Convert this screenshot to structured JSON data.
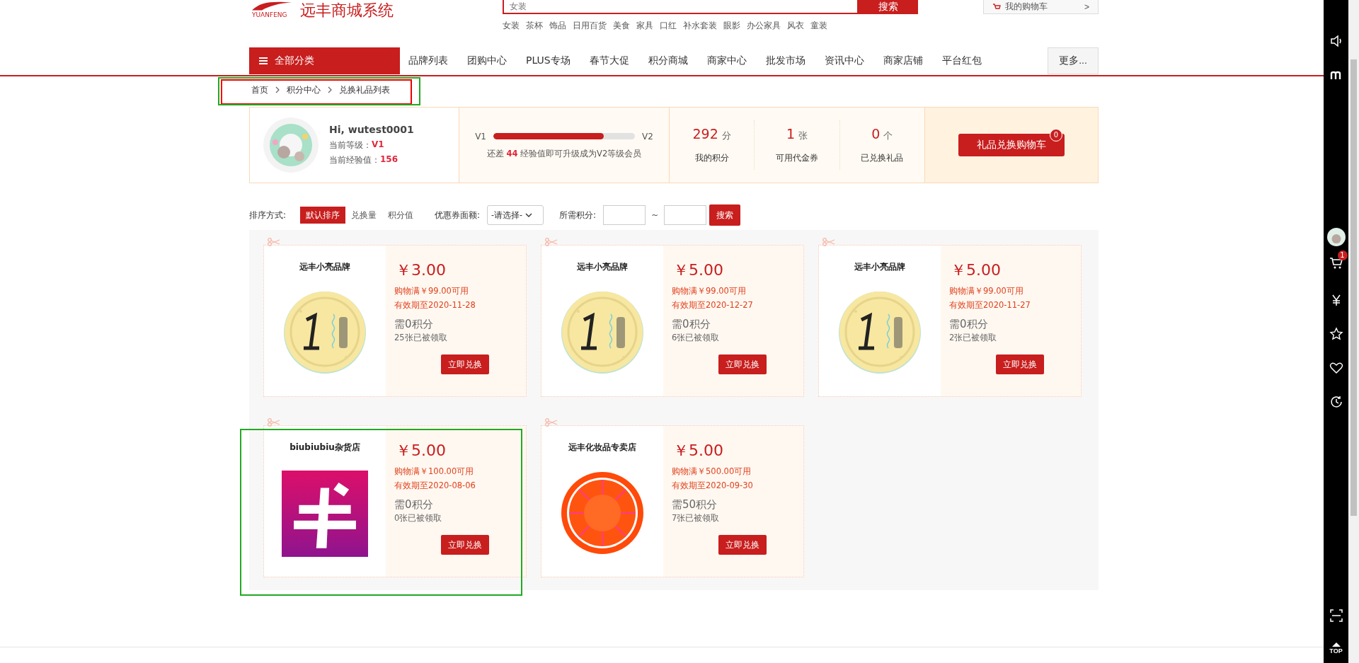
{
  "header": {
    "logo_text": "远丰商城系统",
    "logo_sub": "YUANFENG",
    "search_placeholder": "女装",
    "search_button": "搜索",
    "cart_button": "我的购物车",
    "cart_arrow": ">",
    "hot_words": [
      "女装",
      "茶杯",
      "饰品",
      "日用百货",
      "美食",
      "家具",
      "口红",
      "补水套装",
      "眼影",
      "办公家具",
      "风衣",
      "童装"
    ]
  },
  "nav": {
    "all_categories": "全部分类",
    "items": [
      {
        "label": "品牌列表",
        "selected": false
      },
      {
        "label": "团购中心",
        "selected": false
      },
      {
        "label": "PLUS专场",
        "selected": false
      },
      {
        "label": "春节大促",
        "selected": false
      },
      {
        "label": "积分商城",
        "selected": false
      },
      {
        "label": "商家中心",
        "selected": false
      },
      {
        "label": "批发市场",
        "selected": false
      },
      {
        "label": "资讯中心",
        "selected": false
      },
      {
        "label": "商家店铺",
        "selected": false
      },
      {
        "label": "平台红包",
        "selected": false
      }
    ],
    "more": "更多..."
  },
  "breadcrumb": [
    "首页",
    "积分中心",
    "兑换礼品列表"
  ],
  "user": {
    "greeting": "Hi, wutest0001",
    "level_label": "当前等级：",
    "level": "V1",
    "exp_label": "当前经验值：",
    "exp": "156",
    "progress": {
      "from": "V1",
      "to": "V2",
      "level": 0.78,
      "note_before": "还差",
      "note_value": "44",
      "note_after": "经验值即可升级成为V2等级会员"
    },
    "stats": [
      {
        "value": "292",
        "unit": "分",
        "label": "我的积分"
      },
      {
        "value": "1",
        "unit": "张",
        "label": "可用代金券"
      },
      {
        "value": "0",
        "unit": "个",
        "label": "已兑换礼品"
      }
    ],
    "cart_button": "礼品兑换购物车",
    "cart_count": "0"
  },
  "filters": {
    "sort_label": "排序方式:",
    "sorts": [
      {
        "label": "默认排序",
        "selected": true
      },
      {
        "label": "兑换量",
        "selected": false
      },
      {
        "label": "积分值",
        "selected": false
      }
    ],
    "face_label": "优惠券面额:",
    "face_select": "-请选择-",
    "points_label": "所需积分:",
    "range_sep": "~",
    "search_button": "搜索"
  },
  "coupons": [
    {
      "store": "远丰小亮品牌",
      "kind": "coin",
      "price": "￥3.00",
      "condition": "购物满￥99.00可用",
      "expiry": "有效期至2020-11-28",
      "points": "需0积分",
      "claimed": "25张已被领取",
      "button": "立即兑换"
    },
    {
      "store": "远丰小亮品牌",
      "kind": "coin",
      "price": "￥5.00",
      "condition": "购物满￥99.00可用",
      "expiry": "有效期至2020-12-27",
      "points": "需0积分",
      "claimed": "6张已被领取",
      "button": "立即兑换"
    },
    {
      "store": "远丰小亮品牌",
      "kind": "coin",
      "price": "￥5.00",
      "condition": "购物满￥99.00可用",
      "expiry": "有效期至2020-11-27",
      "points": "需0积分",
      "claimed": "2张已被领取",
      "button": "立即兑换"
    },
    {
      "store": "biubiubiu杂货店",
      "kind": "ticket",
      "price": "￥5.00",
      "condition": "购物满￥100.00可用",
      "expiry": "有效期至2020-08-06",
      "points": "需0积分",
      "claimed": "0张已被领取",
      "button": "立即兑换"
    },
    {
      "store": "远丰化妆品专卖店",
      "kind": "orange",
      "price": "￥5.00",
      "condition": "购物满￥500.00可用",
      "expiry": "有效期至2020-09-30",
      "points": "需50积分",
      "claimed": "7张已被领取",
      "button": "立即兑换"
    }
  ],
  "sidebar": {
    "cart_count": "1",
    "top_label": "TOP"
  }
}
